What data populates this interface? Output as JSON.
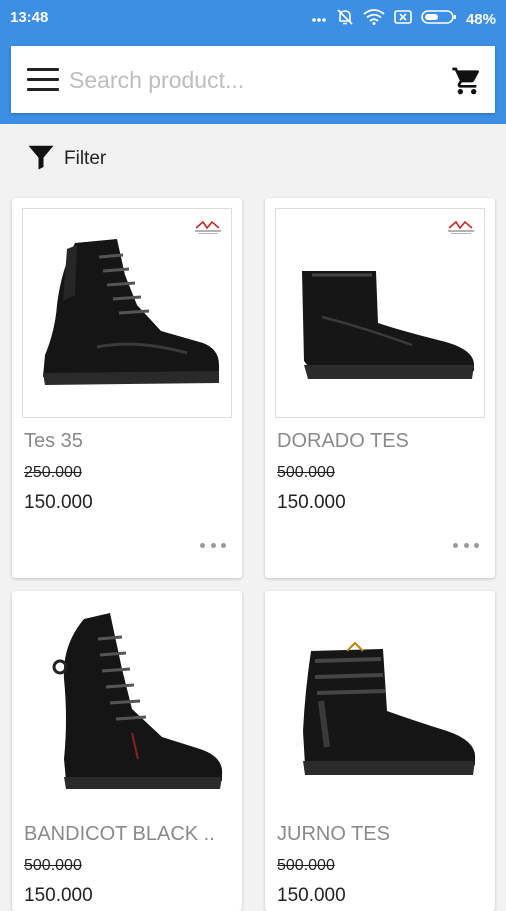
{
  "status_bar": {
    "time": "13:48",
    "battery": "48%"
  },
  "search": {
    "placeholder": "Search product..."
  },
  "filter": {
    "label": "Filter"
  },
  "products": [
    {
      "name": "Tes 35",
      "old_price": "250.000",
      "price": "150.000"
    },
    {
      "name": "DORADO TES",
      "old_price": "500.000",
      "price": "150.000"
    },
    {
      "name": "BANDICOT BLACK ..",
      "old_price": "500.000",
      "price": "150.000"
    },
    {
      "name": "JURNO TES",
      "old_price": "500.000",
      "price": "150.000"
    }
  ],
  "colors": {
    "primary": "#3d8fe4",
    "background": "#f2f2f2"
  }
}
